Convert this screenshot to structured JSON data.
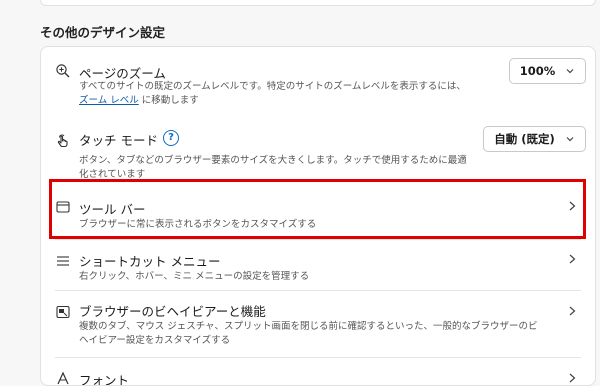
{
  "section_title": "その他のデザイン設定",
  "rows": [
    {
      "title": "ページのズーム",
      "description": "すべてのサイトの既定のズームレベルです。特定のサイトのズームレベルを表示するには、",
      "link_text": "ズーム レベル",
      "link_suffix": " に移動します",
      "dropdown_value": "100%",
      "icon": "zoom-in-icon"
    },
    {
      "title": "タッチ モード",
      "help": "?",
      "description_line1": "ボタン、タブなどのブラウザー要素のサイズを大きくします。タッチで使用するために最適",
      "description_line2": "化されています",
      "dropdown_value": "自動 (既定)",
      "icon": "touch-icon"
    },
    {
      "title": "ツール バー",
      "description": "ブラウザーに常に表示されるボタンをカスタマイズする",
      "icon": "toolbar-icon"
    },
    {
      "title": "ショートカット メニュー",
      "description": "右クリック、ホバー、ミニ メニューの設定を管理する",
      "icon": "menu-icon"
    },
    {
      "title": "ブラウザーのビヘイビアーと機能",
      "description_line1": "複数のタブ、マウス ジェスチャ、スプリット画面を閉じる前に確認するといった、一般的なブラウザーのビ",
      "description_line2": "ヘイビアー設定をカスタマイズする",
      "icon": "browser-behavior-icon"
    },
    {
      "title": "フォント",
      "icon": "font-icon"
    }
  ],
  "colors": {
    "highlight": "#e00000",
    "link": "#0f5ca8",
    "help": "#0f6cbd"
  }
}
